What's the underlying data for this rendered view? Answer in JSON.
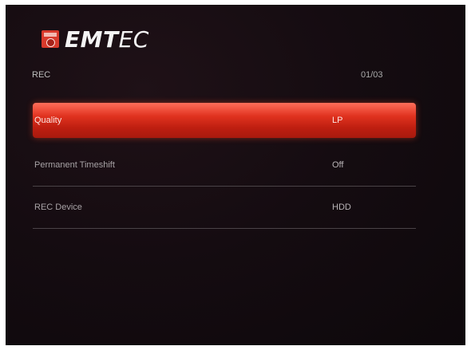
{
  "brand": {
    "logo_bold": "EMT",
    "logo_light": "EC",
    "badge_icon": "emtec-logo-icon"
  },
  "header": {
    "section_title": "REC",
    "page_indicator": "01/03"
  },
  "menu": {
    "items": [
      {
        "label": "Quality",
        "value": "LP",
        "selected": true
      },
      {
        "label": "Permanent Timeshift",
        "value": "Off",
        "selected": false
      },
      {
        "label": "REC Device",
        "value": "HDD",
        "selected": false
      }
    ]
  },
  "colors": {
    "background": "#150c11",
    "highlight": "#d8301c",
    "brand_red": "#d83a2c"
  }
}
